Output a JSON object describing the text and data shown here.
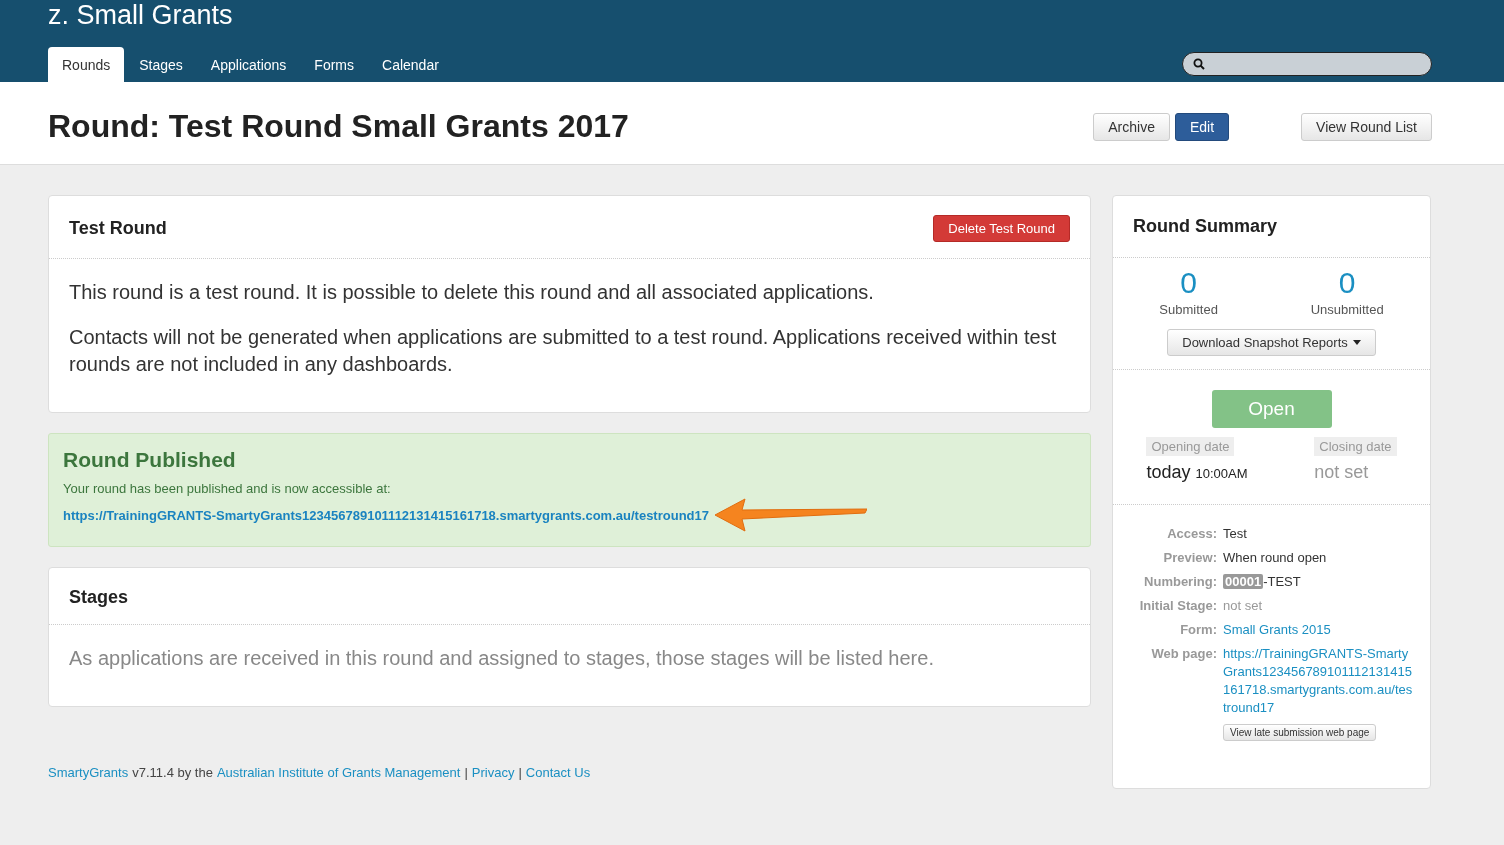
{
  "header": {
    "app_title": "z. Small Grants",
    "tabs": [
      {
        "label": "Rounds",
        "selected": true
      },
      {
        "label": "Stages",
        "selected": false
      },
      {
        "label": "Applications",
        "selected": false
      },
      {
        "label": "Forms",
        "selected": false
      },
      {
        "label": "Calendar",
        "selected": false
      }
    ]
  },
  "page_title": "Round: Test Round Small Grants 2017",
  "title_buttons": [
    {
      "label": "Archive",
      "kind": "default"
    },
    {
      "label": "Edit",
      "kind": "primary"
    },
    {
      "label": "View Round List",
      "kind": "default"
    }
  ],
  "test_round": {
    "title": "Test Round",
    "delete_button": "Delete Test Round",
    "paragraphs": [
      "This round is a test round. It is possible to delete this round and all associated applications.",
      "Contacts will not be generated when applications are submitted to a test round. Applications received within test rounds are not included in any dashboards."
    ]
  },
  "published": {
    "title": "Round Published",
    "message": "Your round has been published and is now accessible at:",
    "url": "https://TrainingGRANTS-SmartyGrants123456789101112131415161718.smartygrants.com.au/testround17"
  },
  "stages": {
    "title": "Stages",
    "message": "As applications are received in this round and assigned to stages, those stages will be listed here."
  },
  "summary": {
    "title": "Round Summary",
    "counts": [
      {
        "value": "0",
        "label": "Submitted"
      },
      {
        "value": "0",
        "label": "Unsubmitted"
      }
    ],
    "download_button": "Download Snapshot Reports",
    "status": "Open",
    "dates": [
      {
        "label": "Opening date",
        "value": "today",
        "time": "10:00AM",
        "set": true
      },
      {
        "label": "Closing date",
        "value": "not set",
        "set": false
      }
    ],
    "details": [
      {
        "label": "Access:",
        "kind": "text",
        "value": "Test"
      },
      {
        "label": "Preview:",
        "kind": "text",
        "value": "When round open"
      },
      {
        "label": "Numbering:",
        "kind": "badge",
        "badge": "00001",
        "value": "-TEST"
      },
      {
        "label": "Initial Stage:",
        "kind": "muted",
        "value": "not set"
      },
      {
        "label": "Form:",
        "kind": "link",
        "value": "Small Grants 2015"
      },
      {
        "label": "Web page:",
        "kind": "link",
        "value": "https://TrainingGRANTS-SmartyGrants123456789101112131415161718.smartygrants.com.au/testround17"
      }
    ],
    "late_button": "View late submission web page"
  },
  "footer": [
    {
      "kind": "link",
      "text": "SmartyGrants"
    },
    {
      "kind": "text",
      "text": "v7.11.4 by the"
    },
    {
      "kind": "link",
      "text": "Australian Institute of Grants Management"
    },
    {
      "kind": "text",
      "text": "|"
    },
    {
      "kind": "link",
      "text": "Privacy"
    },
    {
      "kind": "text",
      "text": "|"
    },
    {
      "kind": "link",
      "text": "Contact Us"
    }
  ]
}
